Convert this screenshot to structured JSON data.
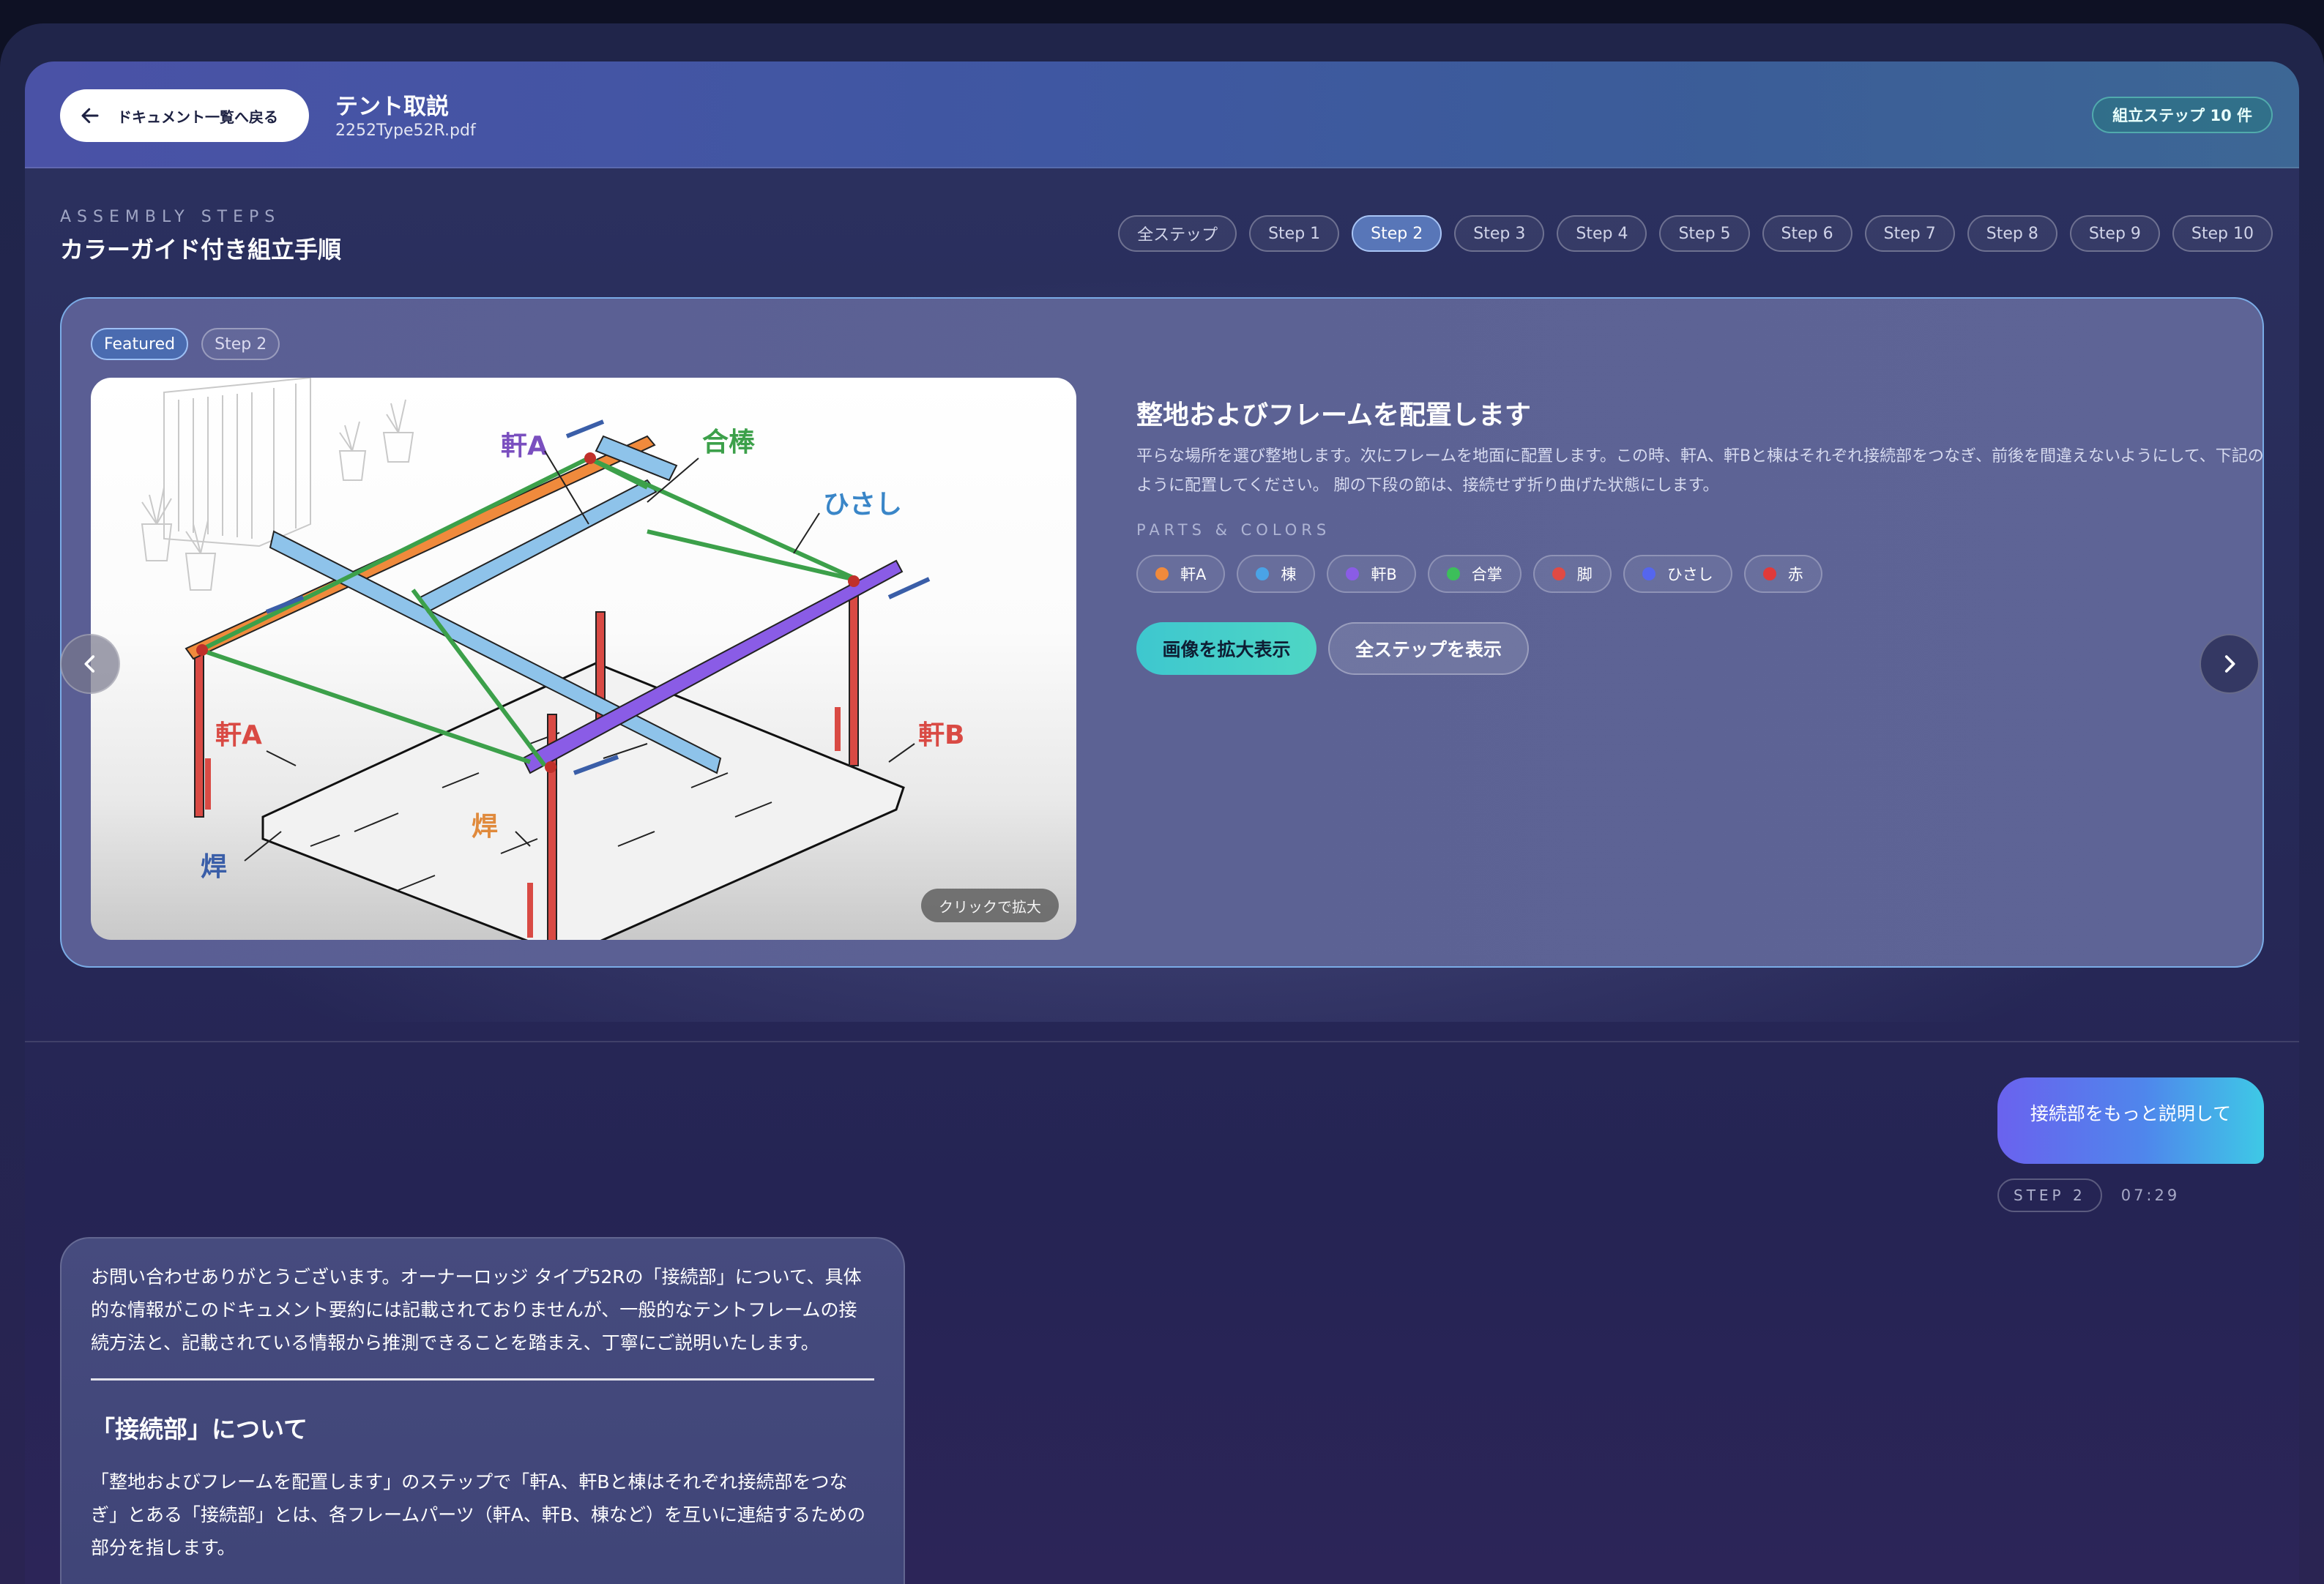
{
  "header": {
    "back_label": "ドキュメント一覧へ戻る",
    "doc_title": "テント取説",
    "doc_file": "2252Type52R.pdf",
    "step_count_badge": "組立ステップ 10 件"
  },
  "steps_section": {
    "kicker": "ASSEMBLY STEPS",
    "title": "カラーガイド付き組立手順",
    "tabs": [
      {
        "label": "全ステップ",
        "active": false
      },
      {
        "label": "Step 1",
        "active": false
      },
      {
        "label": "Step 2",
        "active": true
      },
      {
        "label": "Step 3",
        "active": false
      },
      {
        "label": "Step 4",
        "active": false
      },
      {
        "label": "Step 5",
        "active": false
      },
      {
        "label": "Step 6",
        "active": false
      },
      {
        "label": "Step 7",
        "active": false
      },
      {
        "label": "Step 8",
        "active": false
      },
      {
        "label": "Step 9",
        "active": false
      },
      {
        "label": "Step 10",
        "active": false
      }
    ]
  },
  "featured": {
    "badge_featured": "Featured",
    "badge_step": "Step 2",
    "zoom_hint": "クリックで拡大",
    "heading": "整地およびフレームを配置します",
    "description": "平らな場所を選び整地します。次にフレームを地面に配置します。この時、軒A、軒Bと棟はそれぞれ接続部をつなぎ、前後を間違えないようにして、下記のように配置してください。 脚の下段の節は、接続せず折り曲げた状態にします。",
    "parts_kicker": "PARTS & COLORS",
    "parts": [
      {
        "label": "軒A",
        "color": "#f08a3c"
      },
      {
        "label": "棟",
        "color": "#4aa3e6"
      },
      {
        "label": "軒B",
        "color": "#8a5ce6"
      },
      {
        "label": "合掌",
        "color": "#3cbf5a"
      },
      {
        "label": "脚",
        "color": "#e04a44"
      },
      {
        "label": "ひさし",
        "color": "#5566ee"
      },
      {
        "label": "赤",
        "color": "#e03a3a"
      }
    ],
    "btn_zoom": "画像を拡大表示",
    "btn_all": "全ステップを表示",
    "diagram_labels": {
      "nokiA_top": "軒A",
      "gassho": "合棒",
      "hisashi": "ひさし",
      "nokiA_left": "軒A",
      "nokiB": "軒B",
      "hook_left": "焊",
      "hook_mid": "焊"
    }
  },
  "chat": {
    "user_message": "接続部をもっと説明して",
    "user_step": "STEP 2",
    "user_time": "07:29",
    "bot_intro": "お問い合わせありがとうございます。オーナーロッジ タイプ52Rの「接続部」について、具体的な情報がこのドキュメント要約には記載されておりませんが、一般的なテントフレームの接続方法と、記載されている情報から推測できることを踏まえ、丁寧にご説明いたします。",
    "bot_heading": "「接続部」について",
    "bot_body": "「整地およびフレームを配置します」のステップで「軒A、軒Bと棟はそれぞれ接続部をつなぎ」とある「接続部」とは、各フレームパーツ（軒A、軒B、棟など）を互いに連結するための部分を指します。"
  },
  "colors": {
    "accent_teal": "#3ec7cf",
    "active_tab": "#5876b8",
    "card_border": "#82befa"
  }
}
